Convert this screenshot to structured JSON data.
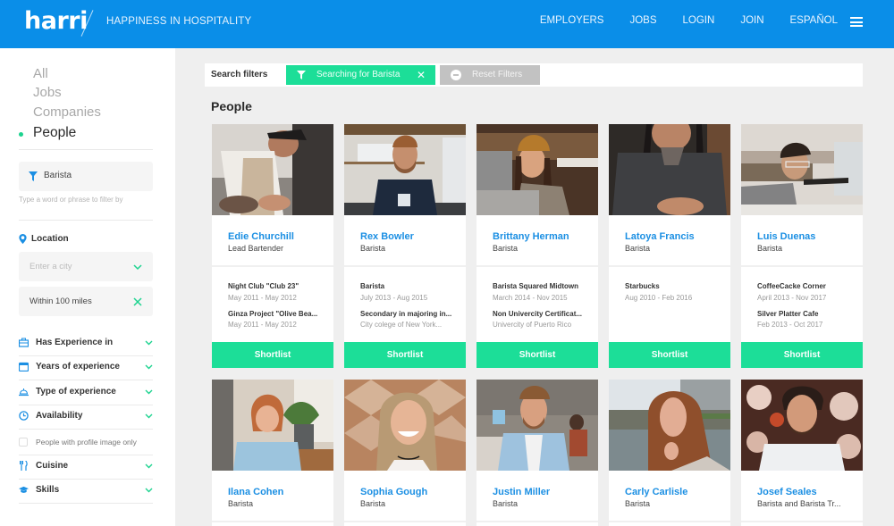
{
  "header": {
    "logo": "harri",
    "tagline": "HAPPINESS IN HOSPITALITY",
    "nav": [
      "EMPLOYERS",
      "JOBS",
      "LOGIN",
      "JOIN",
      "ESPAÑOL"
    ],
    "menu_icon": "hamburger-icon",
    "brand_color": "#0a8ee8"
  },
  "sidebar": {
    "categories": [
      {
        "label": "All",
        "active": false
      },
      {
        "label": "Jobs",
        "active": false
      },
      {
        "label": "Companies",
        "active": false
      },
      {
        "label": "People",
        "active": true
      }
    ],
    "keyword_filter": {
      "value": "Barista",
      "hint": "Type a word or phrase to filter by",
      "icon": "funnel-icon"
    },
    "location": {
      "label": "Location",
      "icon": "map-pin-icon",
      "city_placeholder": "Enter a city",
      "radius": "Within  100 miles"
    },
    "accordions_top": [
      {
        "label": "Has Experience in",
        "icon": "briefcase-icon"
      },
      {
        "label": "Years of experience",
        "icon": "calendar-icon"
      },
      {
        "label": "Type of experience",
        "icon": "cloche-icon"
      },
      {
        "label": "Availability",
        "icon": "clock-icon"
      }
    ],
    "profile_image_checkbox": {
      "label": "People with profile image only",
      "checked": false
    },
    "accordions_bottom": [
      {
        "label": "Cuisine",
        "icon": "cutlery-icon"
      },
      {
        "label": "Skills",
        "icon": "graduation-cap-icon"
      }
    ],
    "accent_color": "#1cd38f"
  },
  "main": {
    "filters_label": "Search filters",
    "active_filter": "Searching for Barista",
    "reset_label": "Reset Filters",
    "section_title": "People",
    "shortlist_label": "Shortlist",
    "accent_color": "#1cde98",
    "people": [
      {
        "name": "Edie Churchill",
        "role": "Lead Bartender",
        "experience": [
          {
            "title": "Night Club \"Club 23\"",
            "detail": "May 2011 - May 2012"
          },
          {
            "title": "Ginza Project \"Olive Bea...",
            "detail": "May 2011 - May 2012"
          }
        ]
      },
      {
        "name": "Rex Bowler",
        "role": "Barista",
        "experience": [
          {
            "title": "Barista",
            "detail": "July 2013 - Aug 2015"
          },
          {
            "title": "Secondary in majoring in...",
            "detail": "City colege of New York..."
          }
        ]
      },
      {
        "name": "Brittany Herman",
        "role": "Barista",
        "experience": [
          {
            "title": "Barista Squared Midtown",
            "detail": "March 2014 - Nov 2015"
          },
          {
            "title": "Non Univercity Certificat...",
            "detail": "Univercity of Puerto Rico"
          }
        ]
      },
      {
        "name": "Latoya Francis",
        "role": "Barista",
        "experience": [
          {
            "title": "Starbucks",
            "detail": "Aug 2010 - Feb 2016"
          }
        ]
      },
      {
        "name": "Luis Duenas",
        "role": "Barista",
        "experience": [
          {
            "title": "CoffeeCacke Corner",
            "detail": "April 2013 - Nov 2017"
          },
          {
            "title": "Silver Platter Cafe",
            "detail": "Feb 2013 - Oct 2017"
          }
        ]
      },
      {
        "name": "Ilana Cohen",
        "role": "Barista",
        "experience": []
      },
      {
        "name": "Sophia Gough",
        "role": "Barista",
        "experience": []
      },
      {
        "name": "Justin Miller",
        "role": "Barista",
        "experience": []
      },
      {
        "name": "Carly Carlisle",
        "role": "Barista",
        "experience": []
      },
      {
        "name": "Josef Seales",
        "role": "Barista and Barista Tr...",
        "experience": []
      }
    ]
  }
}
